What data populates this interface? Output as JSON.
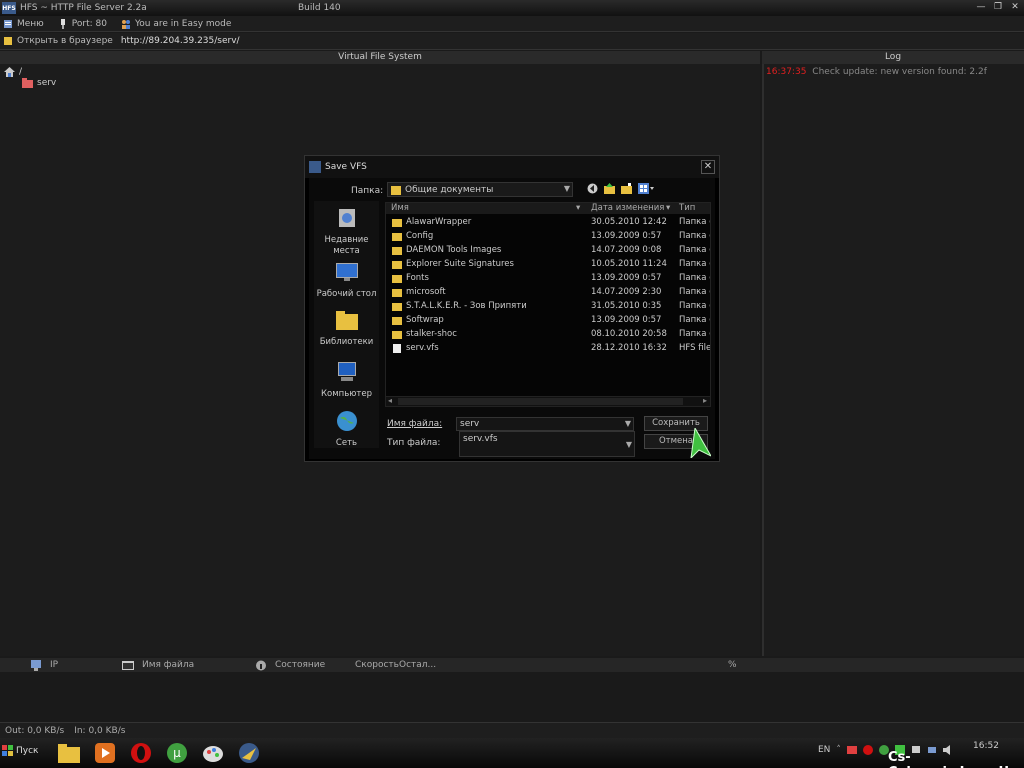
{
  "window": {
    "title": "HFS ~ HTTP File Server 2.2a",
    "build": "Build 140",
    "app_icon": "HFS"
  },
  "toolbar": {
    "menu": "Меню",
    "port": "Port: 80",
    "mode": "You are in Easy mode"
  },
  "urlbar": {
    "open_label": "Открыть в браузере",
    "url": "http://89.204.39.235/serv/"
  },
  "vfs": {
    "header": "Virtual File System",
    "root": "/",
    "child": "serv"
  },
  "log": {
    "header": "Log",
    "time": "16:37:35",
    "message": "Check update: new version found: 2.2f"
  },
  "connections": {
    "ip": "IP",
    "filename": "Имя файла",
    "status": "Состояние",
    "speed": "Скорость",
    "remain": "Остал...",
    "percent": "%"
  },
  "statusbar": {
    "out": "Out: 0,0 KB/s",
    "in": "In: 0,0 KB/s"
  },
  "dialog": {
    "title": "Save VFS",
    "close": "✕",
    "folder_label": "Папка:",
    "folder_value": "Общие документы",
    "places": [
      "Недавние места",
      "Рабочий стол",
      "Библиотеки",
      "Компьютер",
      "Сеть"
    ],
    "columns": {
      "name": "Имя",
      "date": "Дата изменения",
      "type": "Тип"
    },
    "files": [
      {
        "name": "AlawarWrapper",
        "date": "30.05.2010 12:42",
        "type": "Папка с ф",
        "kind": "folder"
      },
      {
        "name": "Config",
        "date": "13.09.2009 0:57",
        "type": "Папка с ф",
        "kind": "folder"
      },
      {
        "name": "DAEMON Tools Images",
        "date": "14.07.2009 0:08",
        "type": "Папка с ф",
        "kind": "folder"
      },
      {
        "name": "Explorer Suite Signatures",
        "date": "10.05.2010 11:24",
        "type": "Папка с ф",
        "kind": "folder"
      },
      {
        "name": "Fonts",
        "date": "13.09.2009 0:57",
        "type": "Папка с ф",
        "kind": "folder"
      },
      {
        "name": "microsoft",
        "date": "14.07.2009 2:30",
        "type": "Папка с ф",
        "kind": "folder"
      },
      {
        "name": "S.T.A.L.K.E.R. - Зов Припяти",
        "date": "31.05.2010 0:35",
        "type": "Папка с ф",
        "kind": "folder"
      },
      {
        "name": "Softwrap",
        "date": "13.09.2009 0:57",
        "type": "Папка с ф",
        "kind": "folder"
      },
      {
        "name": "stalker-shoc",
        "date": "08.10.2010 20:58",
        "type": "Папка с ф",
        "kind": "folder"
      },
      {
        "name": "serv.vfs",
        "date": "28.12.2010 16:32",
        "type": "HFS file sy",
        "kind": "file"
      }
    ],
    "filename_label": "Имя файла:",
    "filename_value": "serv",
    "filetype_label": "Тип файла:",
    "filetype_value": "serv.vfs",
    "save": "Сохранить",
    "cancel": "Отмена"
  },
  "taskbar": {
    "start": "Пуск",
    "lang": "EN",
    "time": "16:52"
  },
  "watermark": "Cs-Calarasi.cLan.sU",
  "colors": {
    "log_time": "#e02020",
    "folder": "#e8c040",
    "accent": "#3a5a8a"
  }
}
